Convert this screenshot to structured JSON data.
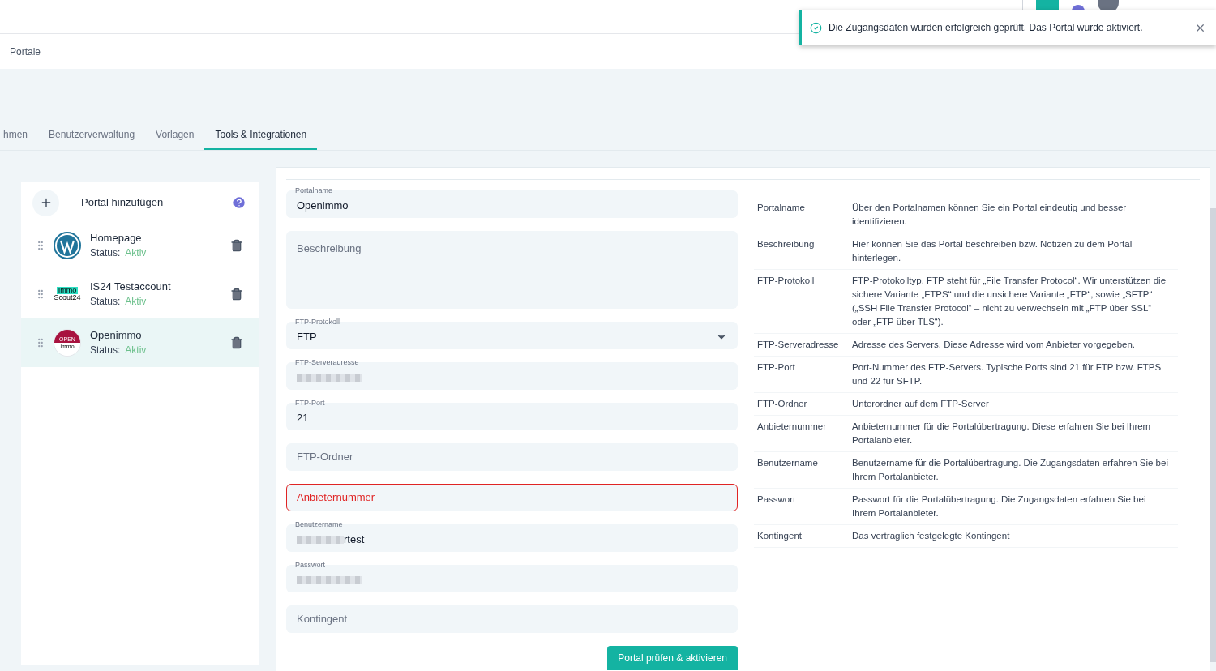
{
  "toast": {
    "message": "Die Zugangsdaten wurden erfolgreich geprüft. Das Portal wurde aktiviert."
  },
  "breadcrumb": "Portale",
  "tabs": [
    {
      "label": "hmen",
      "selected": false
    },
    {
      "label": "Benutzerverwaltung",
      "selected": false
    },
    {
      "label": "Vorlagen",
      "selected": false
    },
    {
      "label": "Tools & Integrationen",
      "selected": true
    }
  ],
  "portals": {
    "add_label": "Portal hinzufügen",
    "items": [
      {
        "name": "Homepage",
        "status_label": "Status:",
        "status": "Aktiv",
        "kind": "wordpress",
        "selected": false
      },
      {
        "name": "IS24 Testaccount",
        "status_label": "Status:",
        "status": "Aktiv",
        "kind": "immoscout",
        "logo_text": [
          "Immo",
          "Scout24"
        ],
        "selected": false
      },
      {
        "name": "Openimmo",
        "status_label": "Status:",
        "status": "Aktiv",
        "kind": "openimmo",
        "logo_text": [
          "OPEN",
          "immo"
        ],
        "selected": true
      }
    ]
  },
  "form": {
    "fields": [
      {
        "kind": "text",
        "label": "Portalname",
        "value": "Openimmo",
        "redacted": false,
        "error": false
      },
      {
        "kind": "textarea",
        "placeholder": "Beschreibung",
        "redacted": false,
        "error": false
      },
      {
        "kind": "select",
        "label": "FTP-Protokoll",
        "value": "FTP",
        "redacted": false,
        "error": false
      },
      {
        "kind": "text",
        "label": "FTP-Serveradresse",
        "redacted": true,
        "error": false
      },
      {
        "kind": "text",
        "label": "FTP-Port",
        "value": "21",
        "redacted": false,
        "error": false
      },
      {
        "kind": "text",
        "placeholder": "FTP-Ordner",
        "redacted": false,
        "error": false
      },
      {
        "kind": "text",
        "placeholder": "Anbieternummer",
        "redacted": false,
        "error": true
      },
      {
        "kind": "text",
        "label": "Benutzername",
        "value": "rtest",
        "redacted": true,
        "error": false
      },
      {
        "kind": "text",
        "label": "Passwort",
        "redacted": true,
        "error": false
      },
      {
        "kind": "text",
        "placeholder": "Kontingent",
        "redacted": false,
        "error": false
      }
    ],
    "submit": "Portal prüfen & aktivieren"
  },
  "help": [
    {
      "term": "Portalname",
      "text": "Über den Portalnamen können Sie ein Portal eindeutig und besser identifizieren."
    },
    {
      "term": "Beschreibung",
      "text": "Hier können Sie das Portal beschreiben bzw. Notizen zu dem Portal hinterlegen."
    },
    {
      "term": "FTP-Protokoll",
      "text": "FTP-Protokolltyp. FTP steht für „File Transfer Protocol“. Wir unterstützen die sichere Variante „FTPS“ und die unsichere Variante „FTP“, sowie „SFTP“ („SSH File Transfer Protocol“ – nicht zu verwechseln mit „FTP über SSL“ oder „FTP über TLS“)."
    },
    {
      "term": "FTP-Serveradresse",
      "text": "Adresse des Servers. Diese Adresse wird vom Anbieter vorgegeben."
    },
    {
      "term": "FTP-Port",
      "text": "Port-Nummer des FTP-Servers. Typische Ports sind 21 für FTP bzw. FTPS und 22 für SFTP."
    },
    {
      "term": "FTP-Ordner",
      "text": "Unterordner auf dem FTP-Server"
    },
    {
      "term": "Anbieternummer",
      "text": "Anbieternummer für die Portalübertragung. Diese erfahren Sie bei Ihrem Portalanbieter."
    },
    {
      "term": "Benutzername",
      "text": "Benutzername für die Portalübertragung. Die Zugangsdaten erfahren Sie bei Ihrem Portalanbieter."
    },
    {
      "term": "Passwort",
      "text": "Passwort für die Portalübertragung. Die Zugangsdaten erfahren Sie bei Ihrem Portalanbieter."
    },
    {
      "term": "Kontingent",
      "text": "Das vertraglich festgelegte Kontingent"
    }
  ]
}
